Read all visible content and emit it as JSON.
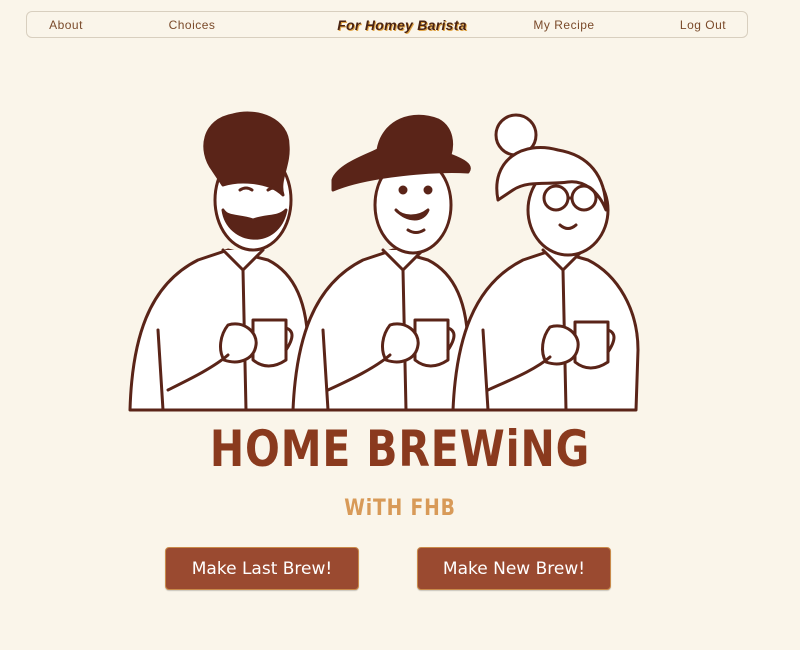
{
  "nav": {
    "about": "About",
    "choices": "Choices",
    "brand": "For Homey Barista",
    "my_recipe": "My Recipe",
    "log_out": "Log Out"
  },
  "hero": {
    "title": "HOME BREWiNG",
    "subtitle": "WiTH FHB",
    "illustration_icon": "three-people-holding-coffee-mugs"
  },
  "actions": {
    "last_brew": "Make Last Brew!",
    "new_brew": "Make New Brew!"
  },
  "colors": {
    "background": "#faf5ea",
    "primary_brown": "#8a3a1e",
    "button": "#9a4a30",
    "accent": "#d89a58",
    "outline": "#4a2412"
  }
}
